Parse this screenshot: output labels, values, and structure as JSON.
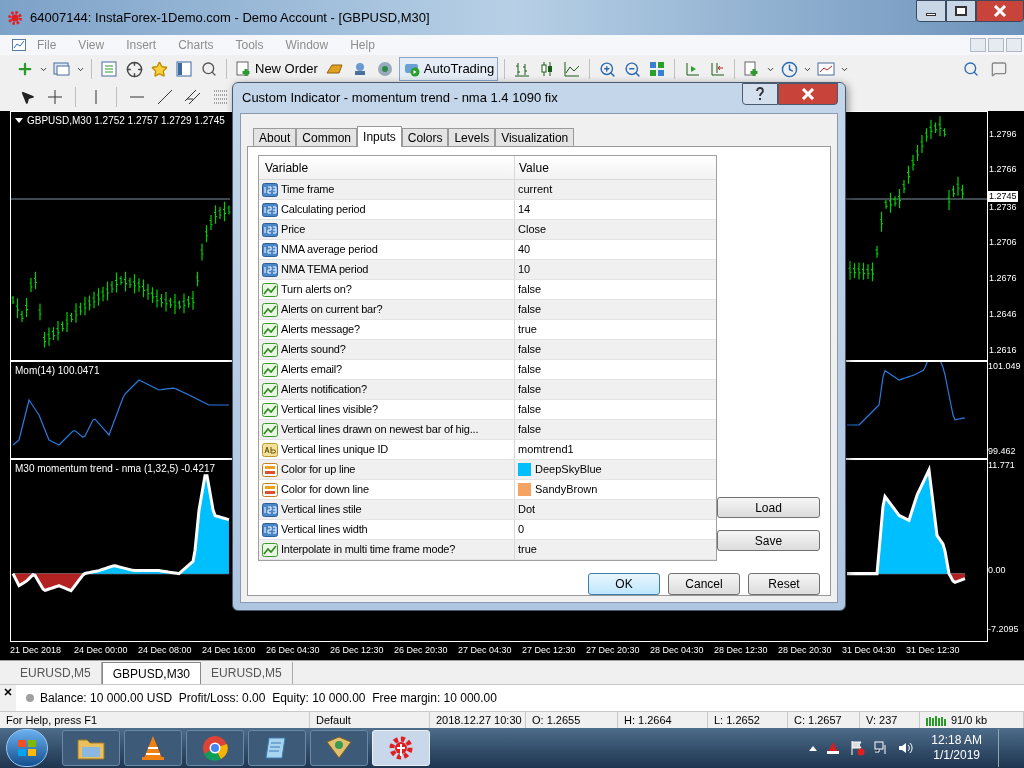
{
  "window": {
    "title": "64007144: InstaForex-1Demo.com - Demo Account - [GBPUSD,M30]"
  },
  "menu": [
    {
      "label": "File",
      "disabled": true
    },
    {
      "label": "View",
      "disabled": true
    },
    {
      "label": "Insert",
      "disabled": true
    },
    {
      "label": "Charts",
      "disabled": true
    },
    {
      "label": "Tools",
      "disabled": true
    },
    {
      "label": "Window",
      "disabled": true
    },
    {
      "label": "Help",
      "disabled": true
    }
  ],
  "toolbar": {
    "new_order": "New Order",
    "auto_trading": "AutoTrading"
  },
  "chart": {
    "price_pane": {
      "label": "GBPUSD,M30  1.2752 1.2757 1.2729 1.2745",
      "ticks": [
        {
          "label": "1.2796",
          "current": false
        },
        {
          "label": "1.2766",
          "current": false
        },
        {
          "label": "1.2745",
          "current": true
        },
        {
          "label": "1.2736",
          "current": false
        },
        {
          "label": "1.2706",
          "current": false
        },
        {
          "label": "1.2676",
          "current": false
        },
        {
          "label": "1.2646",
          "current": false
        },
        {
          "label": "1.2616",
          "current": false
        }
      ]
    },
    "momentum_pane": {
      "label": "Mom(14) 100.0471",
      "ticks": [
        "101.049",
        "99.462"
      ]
    },
    "trend_pane": {
      "label": "M30 momentum trend - nma (1,32,5) -0.4217",
      "ticks": [
        "11.771",
        "0.00",
        "-7.2095"
      ]
    },
    "time_axis": [
      "21 Dec 2018",
      "24 Dec 00:00",
      "24 Dec 08:00",
      "24 Dec 16:00",
      "26 Dec 04:30",
      "26 Dec 12:30",
      "26 Dec 20:30",
      "27 Dec 04:30",
      "27 Dec 12:30",
      "27 Dec 20:30",
      "28 Dec 04:30",
      "28 Dec 12:30",
      "28 Dec 20:30",
      "31 Dec 04:30",
      "31 Dec 12:30"
    ]
  },
  "dialog": {
    "title": "Custom Indicator - momentum trend - nma 1.4 1090 fix",
    "tabs": [
      {
        "label": "About",
        "selected": false
      },
      {
        "label": "Common",
        "selected": false
      },
      {
        "label": "Inputs",
        "selected": true
      },
      {
        "label": "Colors",
        "selected": false
      },
      {
        "label": "Levels",
        "selected": false
      },
      {
        "label": "Visualization",
        "selected": false
      }
    ],
    "columns": [
      "Variable",
      "Value"
    ],
    "rows": [
      {
        "kind": "number",
        "variable": "Time frame",
        "value": "current"
      },
      {
        "kind": "number",
        "variable": "Calculating period",
        "value": "14"
      },
      {
        "kind": "number",
        "variable": "Price",
        "value": "Close"
      },
      {
        "kind": "number",
        "variable": "NMA average period",
        "value": "40"
      },
      {
        "kind": "number",
        "variable": "NMA TEMA period",
        "value": "10"
      },
      {
        "kind": "bool",
        "variable": "Turn alerts on?",
        "value": "false"
      },
      {
        "kind": "bool",
        "variable": "Alerts on current bar?",
        "value": "false"
      },
      {
        "kind": "bool",
        "variable": "Alerts message?",
        "value": "true"
      },
      {
        "kind": "bool",
        "variable": "Alerts sound?",
        "value": "false"
      },
      {
        "kind": "bool",
        "variable": "Alerts email?",
        "value": "false"
      },
      {
        "kind": "bool",
        "variable": "Alerts notification?",
        "value": "false"
      },
      {
        "kind": "bool",
        "variable": "Vertical lines visible?",
        "value": "false"
      },
      {
        "kind": "bool",
        "variable": "Vertical lines drawn on newest bar of hig...",
        "value": "false"
      },
      {
        "kind": "string",
        "variable": "Vertical lines unique ID",
        "value": "momtrend1"
      },
      {
        "kind": "color",
        "variable": "Color for up line",
        "value": "DeepSkyBlue",
        "color": "#00bfff"
      },
      {
        "kind": "color",
        "variable": "Color for down line",
        "value": "SandyBrown",
        "color": "#f4a460"
      },
      {
        "kind": "number",
        "variable": "Vertical lines stile",
        "value": "Dot"
      },
      {
        "kind": "number",
        "variable": "Vertical lines width",
        "value": "0"
      },
      {
        "kind": "bool",
        "variable": "Interpolate in multi time frame mode?",
        "value": "true"
      }
    ],
    "side_buttons": [
      "Load",
      "Save"
    ],
    "buttons": [
      "OK",
      "Cancel",
      "Reset"
    ]
  },
  "chart_tabs": [
    {
      "label": "EURUSD,M5",
      "selected": false
    },
    {
      "label": "GBPUSD,M30",
      "selected": true
    },
    {
      "label": "EURUSD,M5",
      "selected": false
    }
  ],
  "terminal": {
    "summary": "Balance: 10 000.00 USD  Profit/Loss: 0.00  Equity: 10 000.00  Free margin: 10 000.00"
  },
  "status_bar": [
    "For Help, press F1",
    "Default",
    "2018.12.27 10:30",
    "O: 1.2655",
    "H: 1.2664",
    "L: 1.2652",
    "C: 1.2657",
    "V: 237",
    "91/0 kb"
  ],
  "taskbar": {
    "apps": [
      {
        "selected": false
      },
      {
        "selected": false
      },
      {
        "selected": false
      },
      {
        "selected": false
      },
      {
        "selected": false
      },
      {
        "selected": true
      }
    ],
    "time": "12:18 AM",
    "date": "1/1/2019"
  }
}
